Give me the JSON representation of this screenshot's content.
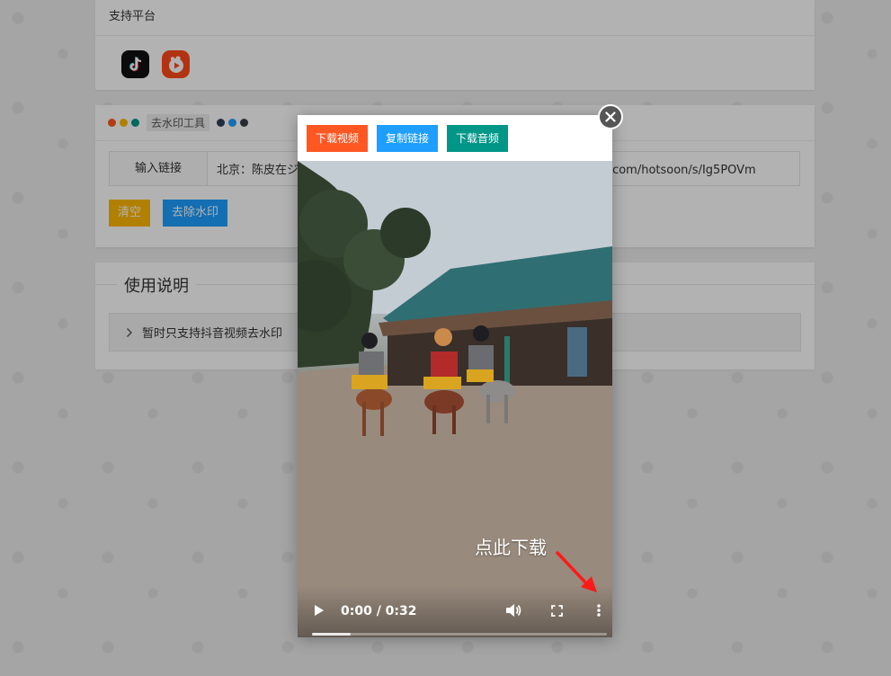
{
  "platforms": {
    "title": "支持平台",
    "icons": [
      "tiktok-icon",
      "kuaishou-icon"
    ]
  },
  "tool": {
    "tag": "去水印工具",
    "input_label": "输入链接",
    "input_value": "北京：陈皮在ジ                                                                        uoshan.com/hotsoon/s/Ig5POVm",
    "clear_label": "清空",
    "remove_label": "去除水印"
  },
  "instructions": {
    "legend": "使用说明",
    "item": "暂时只支持抖音视频去水印"
  },
  "modal": {
    "download_video": "下载视频",
    "copy_link": "复制链接",
    "download_audio": "下载音频",
    "hint": "点此下载",
    "time": "0:00 / 0:32",
    "progress": 0.13
  },
  "colors": {
    "orange": "#ff5722",
    "blue": "#1e9fff",
    "green": "#009688",
    "yellow": "#ffb800"
  }
}
